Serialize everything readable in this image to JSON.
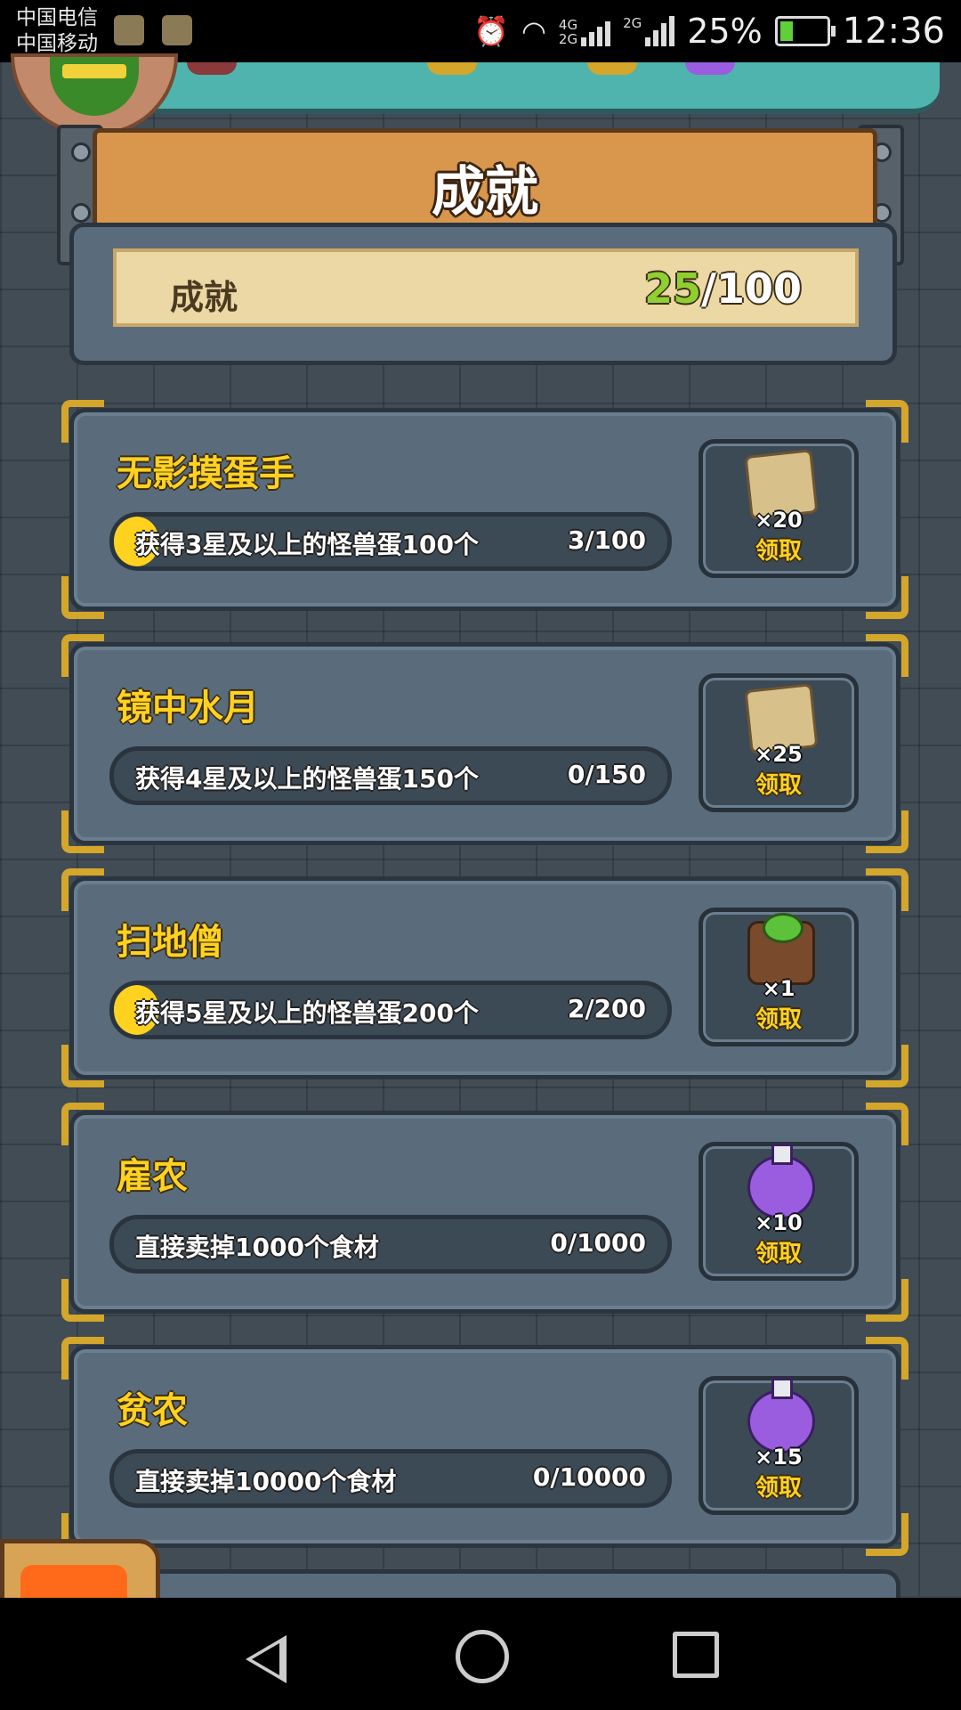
{
  "status_bar": {
    "carrier_1": "中国电信",
    "carrier_2": "中国移动",
    "network_1": "4G",
    "network_2": "2G",
    "network_3": "2G",
    "battery_percent": "25%",
    "battery_level": 0.25,
    "time": "12:36"
  },
  "header": {
    "title": "成就"
  },
  "summary": {
    "label": "成就",
    "completed": "25",
    "total": "/100"
  },
  "achievements": [
    {
      "title": "无影摸蛋手",
      "description": "获得3星及以上的怪兽蛋100个",
      "progress_text": "3/100",
      "progress": 0.03,
      "reward_icon": "scroll-icon",
      "reward_qty": "×20",
      "claim_label": "领取"
    },
    {
      "title": "镜中水月",
      "description": "获得4星及以上的怪兽蛋150个",
      "progress_text": "0/150",
      "progress": 0.0,
      "reward_icon": "scroll-icon",
      "reward_qty": "×25",
      "claim_label": "领取"
    },
    {
      "title": "扫地僧",
      "description": "获得5星及以上的怪兽蛋200个",
      "progress_text": "2/200",
      "progress": 0.01,
      "reward_icon": "chest-icon",
      "reward_qty": "×1",
      "claim_label": "领取"
    },
    {
      "title": "雇农",
      "description": "直接卖掉1000个食材",
      "progress_text": "0/1000",
      "progress": 0.0,
      "reward_icon": "potion-icon",
      "reward_qty": "×10",
      "claim_label": "领取"
    },
    {
      "title": "贫农",
      "description": "直接卖掉10000个食材",
      "progress_text": "0/10000",
      "progress": 0.0,
      "reward_icon": "potion-icon",
      "reward_qty": "×15",
      "claim_label": "领取"
    }
  ],
  "colors": {
    "accent_yellow": "#ffd21f",
    "progress_green": "#8fd030",
    "panel_blue": "#5a6c7c"
  }
}
